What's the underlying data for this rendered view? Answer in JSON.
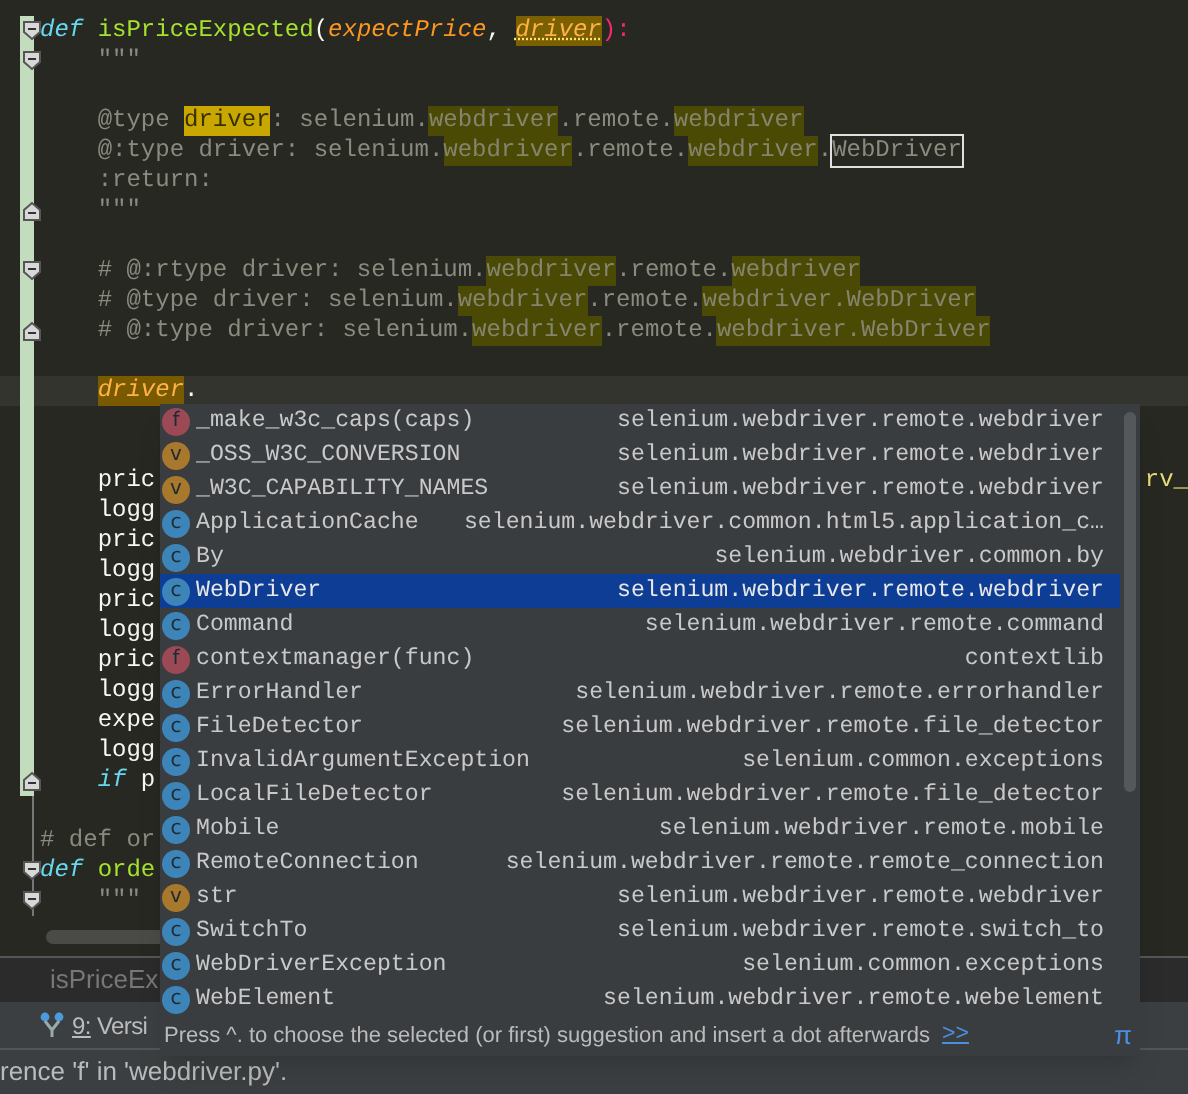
{
  "editor": {
    "lines": [
      {
        "changed": true,
        "fold_open": true,
        "fold_close": false,
        "current": false,
        "segments": [
          {
            "text": "def",
            "kind": "keyword"
          },
          {
            "text": " isPriceExpected",
            "kind": "function"
          },
          {
            "text": "(",
            "kind": "plain"
          },
          {
            "text": "expectPrice",
            "kind": "param"
          },
          {
            "text": ", ",
            "kind": "plain"
          },
          {
            "text": "driver",
            "kind": "param_marked"
          },
          {
            "text": "):",
            "kind": "operator"
          }
        ]
      },
      {
        "changed": true,
        "fold_open": true,
        "fold_close": false,
        "current": false,
        "segments": [
          {
            "text": "    \"\"\"",
            "kind": "doc"
          }
        ]
      },
      {
        "changed": true,
        "fold_open": false,
        "fold_close": false,
        "current": false
      },
      {
        "changed": true,
        "fold_open": false,
        "fold_close": false,
        "current": false,
        "segments": [
          {
            "text": "    @type ",
            "kind": "doc"
          },
          {
            "text": "driver",
            "kind": "strong"
          },
          {
            "text": ": selenium.",
            "kind": "doc"
          },
          {
            "text": "webdriver",
            "kind": "match"
          },
          {
            "text": ".remote.",
            "kind": "doc"
          },
          {
            "text": "webdriver",
            "kind": "match"
          }
        ]
      },
      {
        "changed": true,
        "fold_open": false,
        "fold_close": false,
        "current": false,
        "segments": [
          {
            "text": "    @:type driver: selenium.",
            "kind": "doc"
          },
          {
            "text": "webdriver",
            "kind": "match"
          },
          {
            "text": ".remote.",
            "kind": "doc"
          },
          {
            "text": "webdriver",
            "kind": "match"
          },
          {
            "text": ".",
            "kind": "doc"
          },
          {
            "text": "WebDriver",
            "kind": "boxed"
          }
        ]
      },
      {
        "changed": true,
        "fold_open": false,
        "fold_close": false,
        "current": false,
        "segments": [
          {
            "text": "    :return:",
            "kind": "doc"
          }
        ]
      },
      {
        "changed": true,
        "fold_open": false,
        "fold_close": true,
        "current": false,
        "segments": [
          {
            "text": "    \"\"\"",
            "kind": "doc"
          }
        ]
      },
      {
        "changed": true,
        "fold_open": false,
        "fold_close": false,
        "current": false
      },
      {
        "changed": true,
        "fold_open": true,
        "fold_close": false,
        "current": false,
        "segments": [
          {
            "text": "    # @:rtype driver: selenium.",
            "kind": "doc"
          },
          {
            "text": "webdriver",
            "kind": "match"
          },
          {
            "text": ".remote.",
            "kind": "doc"
          },
          {
            "text": "webdriver",
            "kind": "match"
          }
        ]
      },
      {
        "changed": true,
        "fold_open": false,
        "fold_close": false,
        "current": false,
        "segments": [
          {
            "text": "    # @type driver: selenium.",
            "kind": "doc"
          },
          {
            "text": "webdriver",
            "kind": "match"
          },
          {
            "text": ".remote.",
            "kind": "doc"
          },
          {
            "text": "webdriver.WebDriver",
            "kind": "match"
          }
        ]
      },
      {
        "changed": true,
        "fold_open": false,
        "fold_close": true,
        "current": false,
        "segments": [
          {
            "text": "    # @:type driver: selenium.",
            "kind": "doc"
          },
          {
            "text": "webdriver",
            "kind": "match"
          },
          {
            "text": ".remote.",
            "kind": "doc"
          },
          {
            "text": "webdriver.WebDriver",
            "kind": "match"
          }
        ]
      },
      {
        "changed": true,
        "fold_open": false,
        "fold_close": false,
        "current": false
      },
      {
        "changed": true,
        "fold_open": false,
        "fold_close": false,
        "current": true,
        "segments": [
          {
            "text": "    driver",
            "kind": "caret_word"
          },
          {
            "text": ".",
            "kind": "plain"
          }
        ]
      },
      {
        "changed": true,
        "fold_open": false,
        "fold_close": false,
        "current": false
      },
      {
        "changed": true,
        "fold_open": false,
        "fold_close": false,
        "current": false
      },
      {
        "changed": true,
        "fold_open": false,
        "fold_close": false,
        "current": false,
        "segments": [
          {
            "text": "    pric",
            "kind": "plain"
          }
        ],
        "tail": "rv_"
      },
      {
        "changed": true,
        "fold_open": false,
        "fold_close": false,
        "current": false,
        "segments": [
          {
            "text": "    logg",
            "kind": "plain"
          }
        ]
      },
      {
        "changed": true,
        "fold_open": false,
        "fold_close": false,
        "current": false,
        "segments": [
          {
            "text": "    pric",
            "kind": "plain"
          }
        ]
      },
      {
        "changed": true,
        "fold_open": false,
        "fold_close": false,
        "current": false,
        "segments": [
          {
            "text": "    logg",
            "kind": "plain"
          }
        ]
      },
      {
        "changed": true,
        "fold_open": false,
        "fold_close": false,
        "current": false,
        "segments": [
          {
            "text": "    pric",
            "kind": "plain"
          }
        ]
      },
      {
        "changed": true,
        "fold_open": false,
        "fold_close": false,
        "current": false,
        "segments": [
          {
            "text": "    logg",
            "kind": "plain"
          }
        ]
      },
      {
        "changed": true,
        "fold_open": false,
        "fold_close": false,
        "current": false,
        "segments": [
          {
            "text": "    pric",
            "kind": "plain"
          }
        ]
      },
      {
        "changed": true,
        "fold_open": false,
        "fold_close": false,
        "current": false,
        "segments": [
          {
            "text": "    logg",
            "kind": "plain"
          }
        ]
      },
      {
        "changed": true,
        "fold_open": false,
        "fold_close": false,
        "current": false,
        "segments": [
          {
            "text": "    expe",
            "kind": "plain"
          }
        ]
      },
      {
        "changed": true,
        "fold_open": false,
        "fold_close": false,
        "current": false,
        "segments": [
          {
            "text": "    logg",
            "kind": "plain"
          }
        ]
      },
      {
        "changed": true,
        "fold_open": false,
        "fold_close": true,
        "current": false,
        "segments": [
          {
            "text": "    if",
            "kind": "keyword"
          },
          {
            "text": " p",
            "kind": "plain"
          }
        ]
      },
      {
        "changed": false,
        "fold_open": false,
        "fold_close": false,
        "current": false
      },
      {
        "changed": false,
        "fold_open": false,
        "fold_close": false,
        "current": false,
        "segments": [
          {
            "text": "# def or",
            "kind": "doc"
          }
        ]
      },
      {
        "changed": false,
        "fold_open": true,
        "fold_close": false,
        "current": false,
        "segments": [
          {
            "text": "def",
            "kind": "keyword"
          },
          {
            "text": " orde",
            "kind": "function"
          }
        ]
      },
      {
        "changed": false,
        "fold_open": true,
        "fold_close": false,
        "current": false,
        "segments": [
          {
            "text": "    \"\"\"",
            "kind": "doc"
          }
        ]
      }
    ]
  },
  "completion": {
    "items": [
      {
        "kind": "f",
        "icon": "f",
        "label": "_make_w3c_caps(caps)",
        "location": "selenium.webdriver.remote.webdriver",
        "selected": false
      },
      {
        "kind": "v",
        "icon": "v",
        "label": "_OSS_W3C_CONVERSION",
        "location": "selenium.webdriver.remote.webdriver",
        "selected": false
      },
      {
        "kind": "v",
        "icon": "v",
        "label": "_W3C_CAPABILITY_NAMES",
        "location": "selenium.webdriver.remote.webdriver",
        "selected": false
      },
      {
        "kind": "c",
        "icon": "c",
        "label": "ApplicationCache",
        "location": "selenium.webdriver.common.html5.application_c…",
        "selected": false
      },
      {
        "kind": "c",
        "icon": "c",
        "label": "By",
        "location": "selenium.webdriver.common.by",
        "selected": false
      },
      {
        "kind": "c",
        "icon": "c",
        "label": "WebDriver",
        "location": "selenium.webdriver.remote.webdriver",
        "selected": true
      },
      {
        "kind": "c",
        "icon": "c",
        "label": "Command",
        "location": "selenium.webdriver.remote.command",
        "selected": false
      },
      {
        "kind": "f",
        "icon": "f",
        "label": "contextmanager(func)",
        "location": "contextlib",
        "selected": false
      },
      {
        "kind": "c",
        "icon": "c",
        "label": "ErrorHandler",
        "location": "selenium.webdriver.remote.errorhandler",
        "selected": false
      },
      {
        "kind": "c",
        "icon": "c",
        "label": "FileDetector",
        "location": "selenium.webdriver.remote.file_detector",
        "selected": false
      },
      {
        "kind": "c",
        "icon": "c",
        "label": "InvalidArgumentException",
        "location": "selenium.common.exceptions",
        "selected": false
      },
      {
        "kind": "c",
        "icon": "c",
        "label": "LocalFileDetector",
        "location": "selenium.webdriver.remote.file_detector",
        "selected": false
      },
      {
        "kind": "c",
        "icon": "c",
        "label": "Mobile",
        "location": "selenium.webdriver.remote.mobile",
        "selected": false
      },
      {
        "kind": "c",
        "icon": "c",
        "label": "RemoteConnection",
        "location": "selenium.webdriver.remote.remote_connection",
        "selected": false
      },
      {
        "kind": "v",
        "icon": "v",
        "label": "str",
        "location": "selenium.webdriver.remote.webdriver",
        "selected": false
      },
      {
        "kind": "c",
        "icon": "c",
        "label": "SwitchTo",
        "location": "selenium.webdriver.remote.switch_to",
        "selected": false
      },
      {
        "kind": "c",
        "icon": "c",
        "label": "WebDriverException",
        "location": "selenium.common.exceptions",
        "selected": false
      },
      {
        "kind": "c",
        "icon": "c",
        "label": "WebElement",
        "location": "selenium.webdriver.remote.webelement",
        "selected": false
      }
    ],
    "hint": "Press ^. to choose the selected (or first) suggestion and insert a dot afterwards",
    "hint_link": ">>",
    "pi": "π"
  },
  "tab_bar": {
    "tab": "isPriceEx"
  },
  "tool_bar": {
    "item": "9: Versi"
  },
  "status_bar": {
    "message": "rence 'f' in 'webdriver.py'."
  }
}
